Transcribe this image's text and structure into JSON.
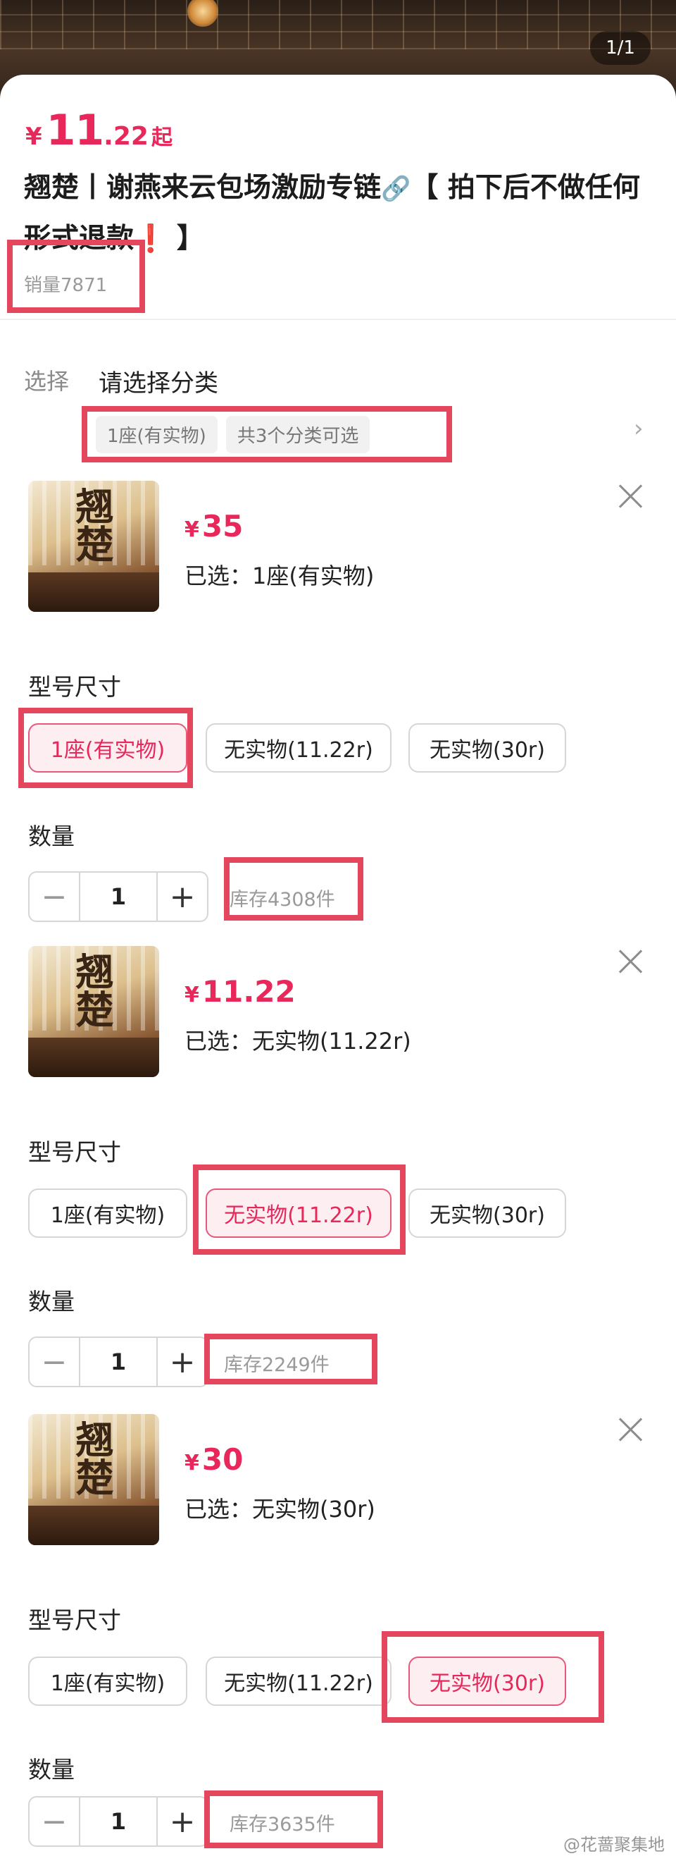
{
  "header": {
    "page_counter": "1/1"
  },
  "product": {
    "price_symbol": "¥",
    "price_int": "11",
    "price_dec": ".22",
    "price_suffix": "起",
    "title_part1": "翘楚丨谢燕来云包场激励专链",
    "title_part2": "【 拍下后不做任何形式退款",
    "title_part3": " 】",
    "sales": "销量7871"
  },
  "selection": {
    "label": "选择",
    "value": "请选择分类",
    "chips": [
      "1座(有实物)",
      "共3个分类可选"
    ]
  },
  "variants": [
    {
      "price": "35",
      "selected_text": "已选：1座(有实物)",
      "size_label": "型号尺寸",
      "options": [
        "1座(有实物)",
        "无实物(11.22r)",
        "无实物(30r)"
      ],
      "selected_index": 0,
      "qty_label": "数量",
      "qty": "1",
      "stock": "库存4308件"
    },
    {
      "price": "11.22",
      "selected_text": "已选：无实物(11.22r)",
      "size_label": "型号尺寸",
      "options": [
        "1座(有实物)",
        "无实物(11.22r)",
        "无实物(30r)"
      ],
      "selected_index": 1,
      "qty_label": "数量",
      "qty": "1",
      "stock": "库存2249件"
    },
    {
      "price": "30",
      "selected_text": "已选：无实物(30r)",
      "size_label": "型号尺寸",
      "options": [
        "1座(有实物)",
        "无实物(11.22r)",
        "无实物(30r)"
      ],
      "selected_index": 2,
      "qty_label": "数量",
      "qty": "1",
      "stock": "库存3635件"
    }
  ],
  "watermark": "@花蔷聚集地",
  "colors": {
    "accent": "#e8275a",
    "highlight_box": "#e3465d"
  }
}
